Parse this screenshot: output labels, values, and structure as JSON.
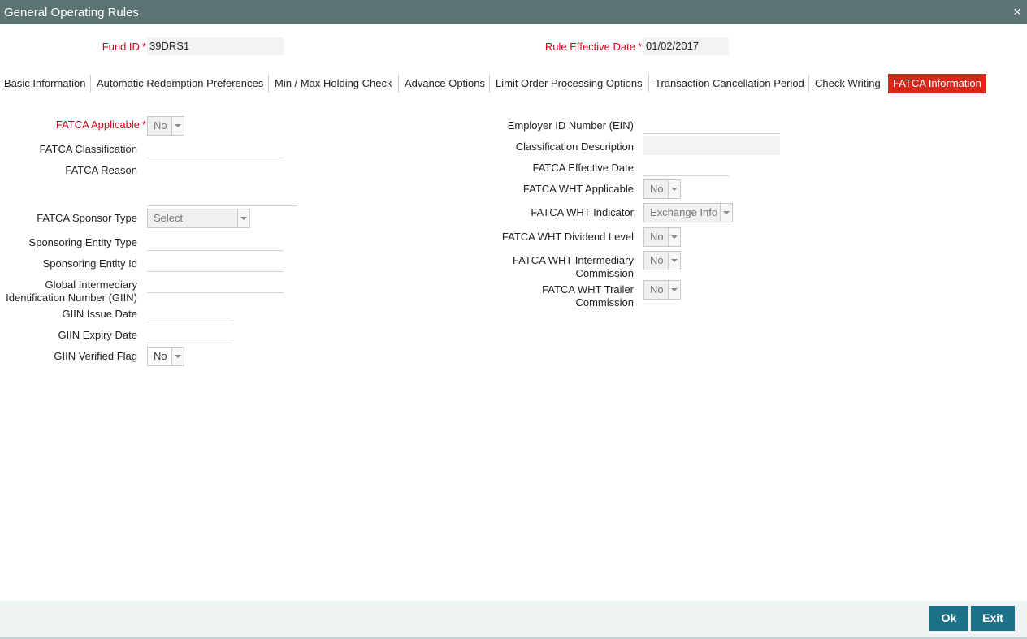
{
  "window": {
    "title": "General Operating Rules",
    "close_icon": "×"
  },
  "header": {
    "fund_id_label": "Fund ID",
    "fund_id_value": "39DRS1",
    "rule_effective_date_label": "Rule Effective Date",
    "rule_effective_date_value": "01/02/2017",
    "required_mark": "*"
  },
  "tabs": [
    {
      "label": "Basic Information"
    },
    {
      "label": "Automatic Redemption Preferences"
    },
    {
      "label": "Min / Max Holding Check"
    },
    {
      "label": "Advance Options"
    },
    {
      "label": "Limit Order Processing Options"
    },
    {
      "label": "Transaction Cancellation Period"
    },
    {
      "label": "Check Writing"
    },
    {
      "label": "FATCA Information",
      "active": true
    }
  ],
  "left": {
    "fatca_applicable_label": "FATCA Applicable",
    "fatca_applicable_value": "No",
    "fatca_classification_label": "FATCA Classification",
    "fatca_reason_label": "FATCA Reason",
    "fatca_sponsor_type_label": "FATCA Sponsor Type",
    "fatca_sponsor_type_value": "Select",
    "sponsoring_entity_type_label": "Sponsoring Entity Type",
    "sponsoring_entity_id_label": "Sponsoring Entity Id",
    "giin_label_line1": "Global Intermediary",
    "giin_label_line2": "Identification Number (GIIN)",
    "giin_issue_date_label": "GIIN Issue Date",
    "giin_expiry_date_label": "GIIN Expiry Date",
    "giin_verified_flag_label": "GIIN Verified Flag",
    "giin_verified_flag_value": "No"
  },
  "right": {
    "ein_label": "Employer ID Number (EIN)",
    "classification_description_label": "Classification Description",
    "fatca_effective_date_label": "FATCA Effective Date",
    "fatca_wht_applicable_label": "FATCA WHT Applicable",
    "fatca_wht_applicable_value": "No",
    "fatca_wht_indicator_label": "FATCA WHT Indicator",
    "fatca_wht_indicator_value": "Exchange Info",
    "fatca_wht_dividend_level_label": "FATCA WHT Dividend Level",
    "fatca_wht_dividend_level_value": "No",
    "fatca_wht_intermediary_label_line1": "FATCA WHT Intermediary",
    "fatca_wht_intermediary_label_line2": "Commission",
    "fatca_wht_intermediary_value": "No",
    "fatca_wht_trailer_label_line1": "FATCA WHT Trailer",
    "fatca_wht_trailer_label_line2": "Commission",
    "fatca_wht_trailer_value": "No"
  },
  "footer": {
    "ok_label": "Ok",
    "exit_label": "Exit"
  },
  "colors": {
    "titlebar": "#5b7473",
    "active_tab": "#d9271c",
    "required": "#d0021b",
    "button": "#1d7187"
  }
}
